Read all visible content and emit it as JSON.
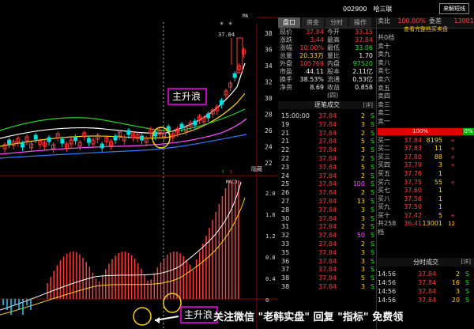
{
  "header": {
    "code": "002900",
    "name": "哈三联",
    "switch_label": "来解短线"
  },
  "tabs": [
    "盘口",
    "资金",
    "分时",
    "操作"
  ],
  "quote": [
    {
      "l1": "现价",
      "v1": "37.84",
      "c1": "red",
      "l2": "今开",
      "v2": "33.15",
      "c2": "red"
    },
    {
      "l1": "涨跌",
      "v1": "3.44",
      "c1": "red",
      "l2": "最高",
      "v2": "37.84",
      "c2": "red"
    },
    {
      "l1": "涨幅",
      "v1": "10.00%",
      "c1": "red",
      "l2": "最低",
      "v2": "33.06",
      "c2": "green"
    },
    {
      "l1": "总量",
      "v1": "20.33万",
      "c1": "yellow",
      "l2": "量比",
      "v2": "1.70",
      "c2": "white"
    },
    {
      "l1": "外盘",
      "v1": "105769",
      "c1": "red",
      "l2": "内盘",
      "v2": "97520",
      "c2": "green"
    },
    {
      "l1": "市盈",
      "v1": "44.11",
      "c1": "white",
      "l2": "股本",
      "v2": "2.11亿",
      "c2": "white"
    },
    {
      "l1": "换手",
      "v1": "38.53%",
      "c1": "white",
      "l2": "流通",
      "v2": "0.53亿",
      "c2": "white"
    },
    {
      "l1": "净资",
      "v1": "8.69",
      "c1": "white",
      "l2": "收益(四)",
      "v2": "0.858",
      "c2": "white"
    }
  ],
  "trades_header": "逐笔成交",
  "trades_detail": "[详]",
  "trades": [
    {
      "t": "15:00:00",
      "p": "37.84",
      "v": "2",
      "d": "S"
    },
    {
      "t": "19",
      "p": "37.84",
      "v": "3",
      "d": "S"
    },
    {
      "t": "21",
      "p": "37.84",
      "v": "2",
      "d": "S"
    },
    {
      "t": "21",
      "p": "37.84",
      "v": "5",
      "d": "S"
    },
    {
      "t": "22",
      "p": "37.84",
      "v": "3",
      "d": "S"
    },
    {
      "t": "22",
      "p": "37.84",
      "v": "2",
      "d": "S"
    },
    {
      "t": "23",
      "p": "37.84",
      "v": "5",
      "d": "S"
    },
    {
      "t": "24",
      "p": "37.84",
      "v": "2",
      "d": "S"
    },
    {
      "t": "25",
      "p": "37.84",
      "v": "100",
      "d": "S"
    },
    {
      "t": "26",
      "p": "37.84",
      "v": "2",
      "d": "S"
    },
    {
      "t": "27",
      "p": "37.84",
      "v": "13",
      "d": "S"
    },
    {
      "t": "28",
      "p": "37.84",
      "v": "3",
      "d": "S"
    },
    {
      "t": "30",
      "p": "37.84",
      "v": "3",
      "d": "S"
    },
    {
      "t": "31",
      "p": "37.84",
      "v": "2",
      "d": "S"
    },
    {
      "t": "32",
      "p": "37.84",
      "v": "50",
      "d": "S"
    },
    {
      "t": "33",
      "p": "37.84",
      "v": "2",
      "d": "S"
    },
    {
      "t": "35",
      "p": "37.84",
      "v": "3",
      "d": "S"
    },
    {
      "t": "36",
      "p": "37.84",
      "v": "3",
      "d": "S"
    },
    {
      "t": "37",
      "p": "37.84",
      "v": "3",
      "d": "S"
    },
    {
      "t": "38",
      "p": "37.84",
      "v": "5",
      "d": "S"
    },
    {
      "t": "38",
      "p": "37.84",
      "v": "3",
      "d": "S"
    }
  ],
  "orderbook": {
    "header": {
      "a": "卖比",
      "b": "100.00%",
      "a2": "委差",
      "c": "13001"
    },
    "hint": "查看完整档买卖盘",
    "sell": [
      "共0档",
      "卖十",
      "卖九",
      "卖八",
      "卖七",
      "卖六",
      "卖五",
      "卖四",
      "卖三",
      "卖二",
      "卖一"
    ],
    "ratio_left": "100%",
    "ratio_right": "0%",
    "buy": [
      {
        "lab": "买一",
        "pr": "37.84",
        "vo": "8195",
        "ch": "+"
      },
      {
        "lab": "买二",
        "pr": "37.83",
        "vo": "11",
        "ch": "+"
      },
      {
        "lab": "买三",
        "pr": "37.80",
        "vo": "88",
        "ch": "+"
      },
      {
        "lab": "买四",
        "pr": "37.79",
        "vo": "3",
        "ch": "+"
      },
      {
        "lab": "买五",
        "pr": "37.76",
        "vo": "1",
        "ch": ""
      },
      {
        "lab": "买六",
        "pr": "37.75",
        "vo": "55",
        "ch": "+"
      },
      {
        "lab": "买七",
        "pr": "37.60",
        "vo": "1",
        "ch": ""
      },
      {
        "lab": "买八",
        "pr": "37.56",
        "vo": "1",
        "ch": ""
      },
      {
        "lab": "买九",
        "pr": "37.50",
        "vo": "1",
        "ch": ""
      },
      {
        "lab": "买十",
        "pr": "37.42",
        "vo": "5",
        "ch": "+"
      }
    ],
    "total": {
      "lab": "共258档",
      "pr": "36.41",
      "vo": "13001",
      "ch": "12"
    }
  },
  "fenshi_header": "分时成交",
  "fenshi_detail": "[详]",
  "fenshi": [
    {
      "t": "14:56",
      "p": "37.84",
      "v": "2",
      "d": "S"
    },
    {
      "t": "14:56",
      "p": "37.84",
      "v": "16",
      "d": "S"
    },
    {
      "t": "14:56",
      "p": "37.84",
      "v": "3",
      "d": "S"
    },
    {
      "t": "14:56",
      "p": "37.84",
      "v": "20",
      "d": "S"
    }
  ],
  "chart": {
    "price_axis": [
      "38",
      "36",
      "34",
      "32",
      "30",
      "28",
      "26",
      "24",
      "22"
    ],
    "ma_label": "MA",
    "high_label": "37.84",
    "stars": "* *",
    "macd_label": "MACD",
    "macd_axis": [
      "2.0",
      "1.6",
      "1.2",
      "0.8",
      "0.4",
      "0"
    ],
    "hide_label": "隐藏",
    "main_wave_label": "主升浪",
    "main_wave_label2": "主升浪"
  },
  "watermark": "关注微信 \"老韩实盘\" 回复 \"指标\" 免费领",
  "colors": {
    "up": "#ff3b3b",
    "down": "#22e022",
    "annotation": "#ff00ff"
  }
}
